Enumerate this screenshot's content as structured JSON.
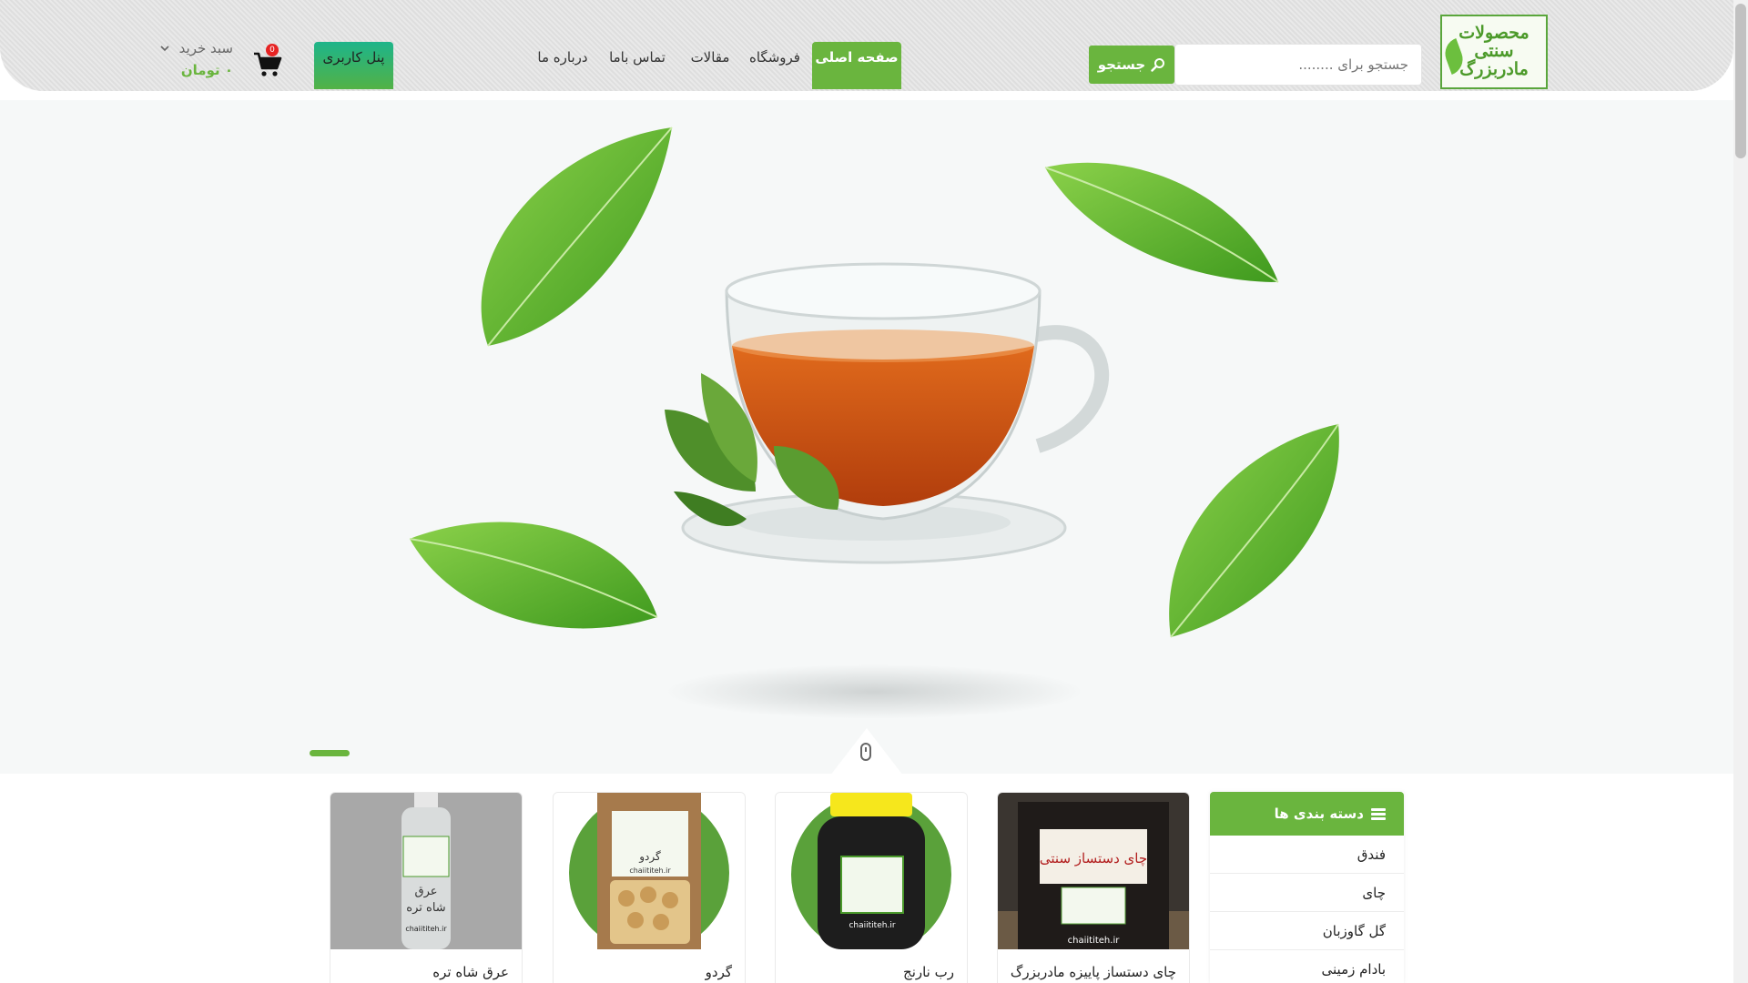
{
  "brand": {
    "logo_line1": "محصولات",
    "logo_line2": "سنتی",
    "logo_line3": "مادربزرگ"
  },
  "search": {
    "placeholder": "جستجو برای ........",
    "button_label": "جستجو"
  },
  "nav": {
    "items": [
      {
        "label": "صفحه اصلی",
        "active": true
      },
      {
        "label": "فروشگاه",
        "active": false
      },
      {
        "label": "مقالات",
        "active": false
      },
      {
        "label": "تماس باما",
        "active": false
      },
      {
        "label": "درباره ما",
        "active": false
      }
    ]
  },
  "user_panel": {
    "label": "پنل کاربری"
  },
  "cart": {
    "badge_count": "0",
    "label": "سبد خرید",
    "total": "۰ تومان"
  },
  "colors": {
    "accent": "#6ab53e",
    "badge": "#e62323",
    "header_bg": "#e4e4e4"
  },
  "hero": {
    "slide_index": 1,
    "image": "tea-cup-with-leaves"
  },
  "categories": {
    "title": "دسته بندی ها",
    "items": [
      "فندق",
      "چای",
      "گل گاوزبان",
      "بادام زمینی"
    ]
  },
  "products": [
    {
      "name": "چای دستساز پاییزه مادربزرگ",
      "image": "tea-bag"
    },
    {
      "name": "رب نارنج",
      "image": "jar"
    },
    {
      "name": "گردو",
      "image": "walnut-bag"
    },
    {
      "name": "عرق شاه تره",
      "image": "bottle"
    }
  ],
  "product_labels": {
    "tea_pack_title": "چای دستساز سنتی",
    "site": "chaiititeh.ir",
    "walnut_label": "گردو",
    "bottle_line1": "عرق",
    "bottle_line2": "شاه تره"
  }
}
